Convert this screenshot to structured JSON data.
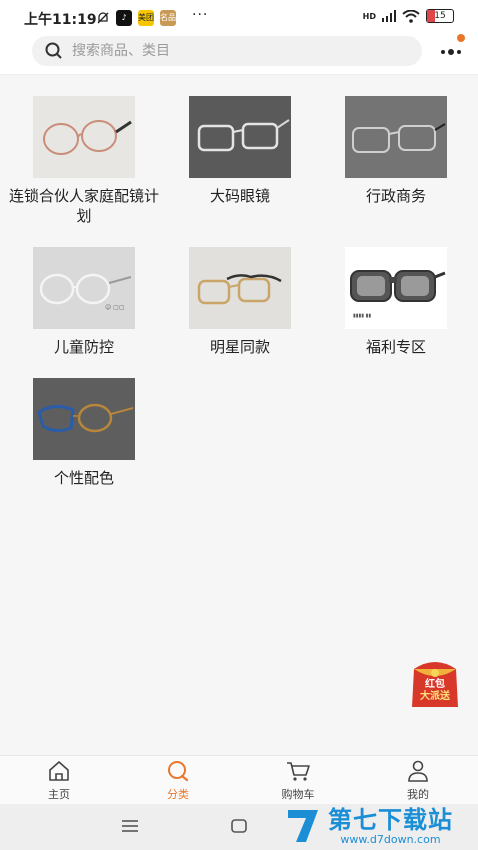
{
  "status_bar": {
    "time": "上午11:19",
    "app_badge_1": "美团",
    "app_badge_2": "名品",
    "more": "···",
    "network": "HD",
    "battery": "15"
  },
  "search": {
    "placeholder": "搜索商品、类目"
  },
  "categories": [
    {
      "label": "连锁合伙人家庭配镜计划"
    },
    {
      "label": "大码眼镜"
    },
    {
      "label": "行政商务"
    },
    {
      "label": "儿童防控"
    },
    {
      "label": "明星同款"
    },
    {
      "label": "福利专区"
    },
    {
      "label": "个性配色"
    }
  ],
  "red_packet": {
    "line1": "红包",
    "line2": "大派送"
  },
  "tabbar": {
    "home": "主页",
    "category": "分类",
    "cart": "购物车",
    "mine": "我的"
  },
  "watermark": {
    "brand": "第七下载站",
    "url": "www.d7down.com"
  },
  "colors": {
    "accent": "#e8772c",
    "watermark": "#1b8ed6"
  }
}
